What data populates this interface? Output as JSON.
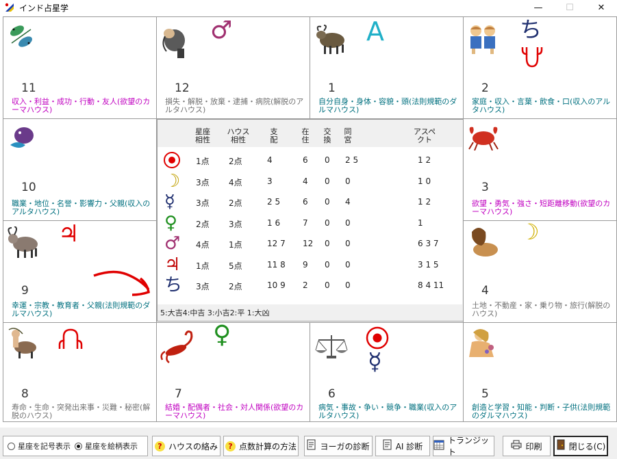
{
  "window": {
    "title": "インド占星学",
    "minimize": "—",
    "maximize": "☐",
    "close": "✕"
  },
  "houses": [
    {
      "pos": "top-1",
      "num": "11",
      "desc": "収入・利益・成功・行動・友人(欲望のカーマハウス)",
      "color": "#c000c0",
      "sign": "pisces-icon",
      "planets": []
    },
    {
      "pos": "top-2",
      "num": "12",
      "desc": "損失・解脱・放棄・逮捕・病院(解脱のアルタハウス)",
      "color": "#707070",
      "sign": "aquarius-icon",
      "planets": [
        "♂"
      ]
    },
    {
      "pos": "top-3",
      "num": "1",
      "desc": "自分自身・身体・容貌・頭(法則規範のダルマハウス)",
      "color": "#00707f",
      "sign": "aries-icon",
      "planets": [
        "A"
      ]
    },
    {
      "pos": "top-4",
      "num": "2",
      "desc": "家庭・収入・言葉・飲食・口(収入のアルタハウス)",
      "color": "#00707f",
      "sign": "gemini-icon",
      "planets": [
        "ち",
        "ラ"
      ]
    },
    {
      "pos": "left-1",
      "num": "10",
      "desc": "職業・地位・名誉・影響力・父親(収入のアルタハウス)",
      "color": "#00707f",
      "sign": "capricorn-icon",
      "planets": []
    },
    {
      "pos": "right-1",
      "num": "3",
      "desc": "欲望・勇気・強さ・短距離移動(欲望のカーマハウス)",
      "color": "#c000c0",
      "sign": "cancer-icon",
      "planets": []
    },
    {
      "pos": "left-2",
      "num": "9",
      "desc": "幸運・宗教・教育者・父親(法則規範のダルマハウス)",
      "color": "#00707f",
      "sign": "sagittarius-goat-icon",
      "planets": [
        "♃"
      ]
    },
    {
      "pos": "right-2",
      "num": "4",
      "desc": "土地・不動産・家・乗り物・旅行(解脱のハウス)",
      "color": "#707070",
      "sign": "leo-icon",
      "planets": [
        "☽"
      ]
    },
    {
      "pos": "bot-1",
      "num": "8",
      "desc": "寿命・生命・突発出来事・災難・秘密(解脱のハウス)",
      "color": "#707070",
      "sign": "sagittarius-icon",
      "planets": [
        "ケ"
      ]
    },
    {
      "pos": "bot-2",
      "num": "7",
      "desc": "結婚・配偶者・社会・対人関係(欲望のカーマハウス)",
      "color": "#c000c0",
      "sign": "scorpio-icon",
      "planets": [
        "♀"
      ]
    },
    {
      "pos": "bot-3",
      "num": "6",
      "desc": "病気・事故・争い・競争・職業(収入のアルタハウス)",
      "color": "#00707f",
      "sign": "libra-icon",
      "planets": [
        "☉",
        "☿"
      ]
    },
    {
      "pos": "bot-4",
      "num": "5",
      "desc": "創造と学習・知能・判断・子供(法則規範のダルマハウス)",
      "color": "#00707f",
      "sign": "virgo-icon",
      "planets": []
    }
  ],
  "table": {
    "headers": {
      "seiza": "星座\n相性",
      "house": "ハウス\n相性",
      "shihai": "支\n配",
      "zaijuu": "在\n住",
      "koukan": "交\n換",
      "doukyu": "同\n宮",
      "aspect": "アスペ\nクト"
    },
    "rows": [
      {
        "planet": "sun",
        "glyph": "☉",
        "color": "#e00000",
        "seiza": "1点",
        "house": "2点",
        "shihai": "4",
        "zaijuu": "6",
        "koukan": "0",
        "doukyu": "2 5",
        "aspect": "1 2"
      },
      {
        "planet": "moon",
        "glyph": "☽",
        "color": "#c0a000",
        "seiza": "3点",
        "house": "4点",
        "shihai": "3",
        "zaijuu": "4",
        "koukan": "0",
        "doukyu": "0",
        "aspect": "1 0"
      },
      {
        "planet": "mercury",
        "glyph": "☿",
        "color": "#203070",
        "seiza": "3点",
        "house": "2点",
        "shihai": "2 5",
        "zaijuu": "6",
        "koukan": "0",
        "doukyu": "4",
        "aspect": "1 2"
      },
      {
        "planet": "venus",
        "glyph": "♀",
        "color": "#209020",
        "seiza": "2点",
        "house": "3点",
        "shihai": "1 6",
        "zaijuu": "7",
        "koukan": "0",
        "doukyu": "0",
        "aspect": "1"
      },
      {
        "planet": "mars",
        "glyph": "♂",
        "color": "#a03070",
        "seiza": "4点",
        "house": "1点",
        "shihai": "12 7",
        "zaijuu": "12",
        "koukan": "0",
        "doukyu": "0",
        "aspect": "6 3 7"
      },
      {
        "planet": "jupiter",
        "glyph": "♃",
        "color": "#c00000",
        "seiza": "1点",
        "house": "5点",
        "shihai": "11 8",
        "zaijuu": "9",
        "koukan": "0",
        "doukyu": "0",
        "aspect": "3 1 5"
      },
      {
        "planet": "saturn",
        "glyph": "ち",
        "color": "#203070",
        "seiza": "3点",
        "house": "2点",
        "shihai": "10 9",
        "zaijuu": "2",
        "koukan": "0",
        "doukyu": "0",
        "aspect": "8 4 11"
      }
    ],
    "legend": "5:大吉4:中吉 3:小吉2:平 1:大凶"
  },
  "bottom": {
    "radio1": "星座を記号表示",
    "radio2": "星座を絵柄表示",
    "btn_house": "ハウスの絡み",
    "btn_points": "点数計算の方法",
    "btn_yoga": "ヨーガの診断",
    "btn_ai": "AI 診断",
    "btn_transit": "トランジット",
    "btn_print": "印刷",
    "btn_close": "閉じる(C)"
  },
  "colors": {
    "pink": "#c000c0",
    "teal": "#00707f",
    "gray": "#707070",
    "arrow": "#e00000"
  }
}
